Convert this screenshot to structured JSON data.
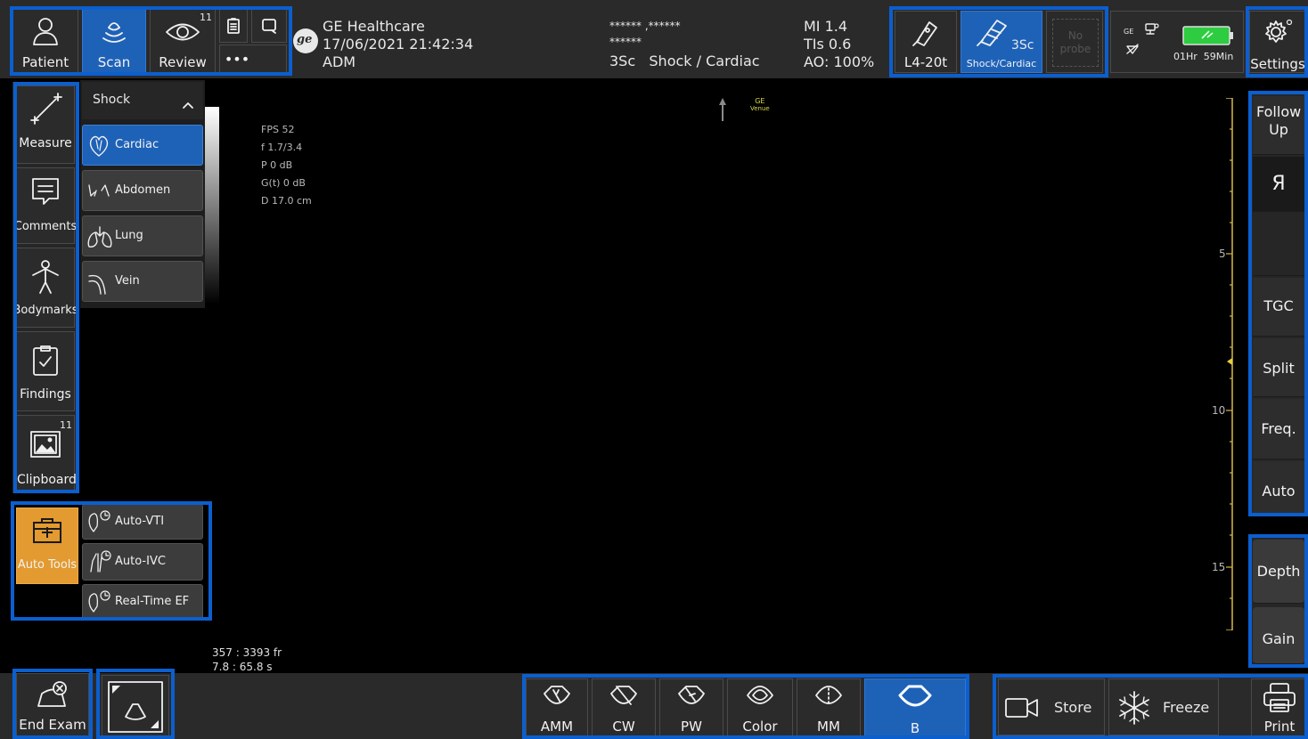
{
  "top_nav": {
    "patient": "Patient",
    "scan": "Scan",
    "review": "Review",
    "review_badge": "11",
    "more": "•••"
  },
  "header": {
    "company": "GE Healthcare",
    "datetime": "17/06/2021 21:42:34",
    "user": "ADM",
    "patient_line1": "****** ,******",
    "patient_line2": "******",
    "preset_line": "3Sc   Shock / Cardiac",
    "mi": "MI 1.4",
    "tis": "TIs 0.6",
    "ao": "AO: 100%"
  },
  "probes": {
    "probe1": "L4-20t",
    "probe2_model": "3Sc",
    "probe2_preset": "Shock/Cardiac",
    "probe3": "No probe"
  },
  "system": {
    "battery_time": "01Hr  59Min",
    "settings": "Settings",
    "ge_small": "GE"
  },
  "left_tools": {
    "measure": "Measure",
    "comments": "Comments",
    "bodymarks": "Bodymarks",
    "findings": "Findings",
    "clipboard": "Clipboard",
    "clipboard_badge": "11"
  },
  "presets": {
    "category": "Shock",
    "items": [
      "Cardiac",
      "Abdomen",
      "Lung",
      "Vein"
    ]
  },
  "auto_tools": {
    "label": "Auto Tools",
    "items": [
      "Auto-VTI",
      "Auto-IVC",
      "Real-Time EF"
    ]
  },
  "image_params": {
    "fps": "FPS 52",
    "freq": "f 1.7/3.4",
    "power": "P 0 dB",
    "gain": "G(t)  0 dB",
    "depth": "D 17.0 cm",
    "logo": "GE",
    "logo_sub": "Venue",
    "frames": "357 : 3393 fr",
    "time": "7.8 : 65.8 s"
  },
  "depth_scale": {
    "ticks": [
      "5",
      "10",
      "15"
    ]
  },
  "right_panel": {
    "follow_up": "Follow Up",
    "orientation": "Я",
    "tgc": "TGC",
    "split": "Split",
    "freq": "Freq.",
    "auto": "Auto",
    "depth": "Depth",
    "gain": "Gain"
  },
  "bottom": {
    "end_exam": "End Exam",
    "modes": [
      "AMM",
      "CW",
      "PW",
      "Color",
      "MM",
      "B"
    ],
    "store": "Store",
    "freeze": "Freeze",
    "print": "Print"
  },
  "colors": {
    "accent": "#1e62b8",
    "group_border": "#0b5fcf",
    "orange": "#e39a30",
    "battery": "#2ecc40",
    "scale": "#d9b84a"
  }
}
